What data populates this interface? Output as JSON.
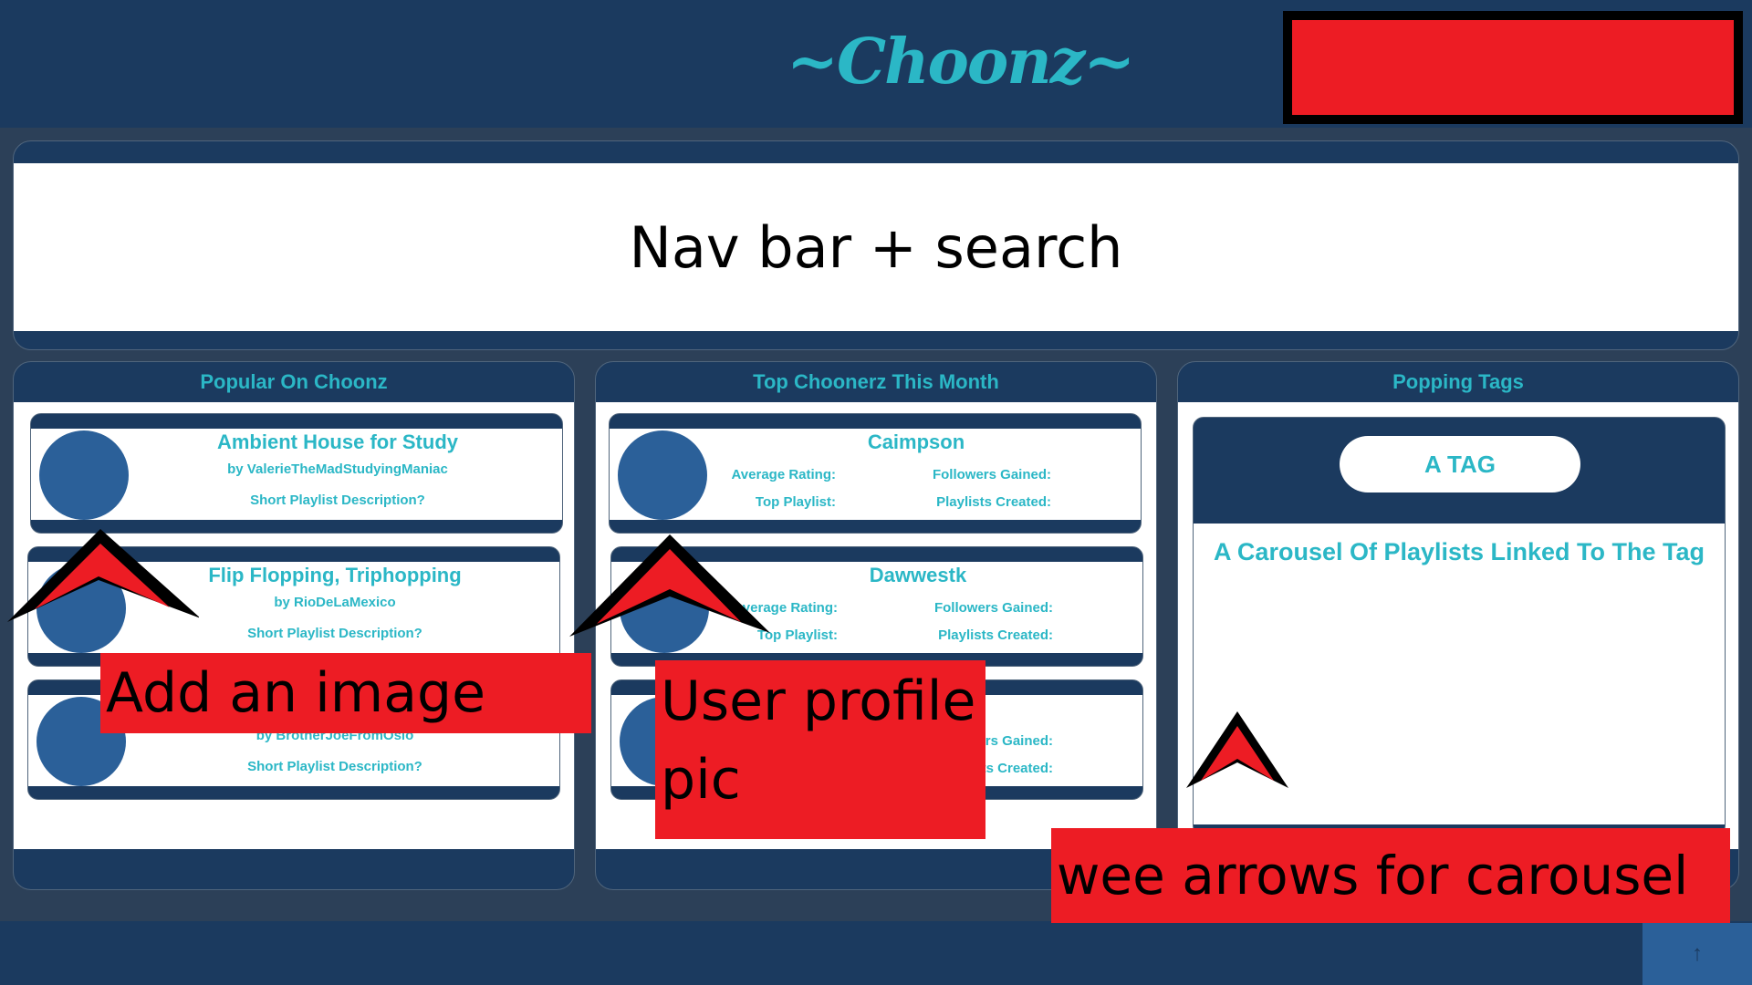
{
  "header": {
    "logo": "~Choonz~"
  },
  "nav": {
    "placeholder_text": "Nav bar + search"
  },
  "columns": {
    "popular": {
      "title": "Popular On Choonz",
      "cards": [
        {
          "title": "Ambient House for Study",
          "author": "by ValerieTheMadStudyingManiac",
          "description": "Short Playlist Description?"
        },
        {
          "title": "Flip Flopping, Triphopping",
          "author": "by RioDeLaMexico",
          "description": "Short Playlist Description?"
        },
        {
          "title": "",
          "author": "by BrotherJoeFromOslo",
          "description": "Short Playlist Description?"
        }
      ]
    },
    "top_users": {
      "title": "Top Choonerz This Month",
      "labels": {
        "avg_rating": "Average Rating:",
        "followers": "Followers Gained:",
        "top_playlist": "Top Playlist:",
        "playlists_created": "Playlists Created:"
      },
      "cards": [
        {
          "name": "Caimpson"
        },
        {
          "name": "Dawwestk"
        },
        {
          "name": ""
        }
      ]
    },
    "tags": {
      "title": "Popping Tags",
      "tag_label": "A TAG",
      "carousel_caption": "A Carousel Of Playlists Linked To The Tag"
    }
  },
  "annotations": {
    "add_image": "Add an image",
    "user_profile_pic": "User profile pic",
    "carousel_arrows": "wee arrows for carousel"
  },
  "footer": {
    "scroll_top_icon": "arrow-up-icon",
    "scroll_top_glyph": "↑"
  },
  "colors": {
    "navy": "#1b3a5f",
    "teal": "#2bb7c6",
    "avatar_blue": "#2b6099",
    "annotation_red": "#ed1c24"
  }
}
